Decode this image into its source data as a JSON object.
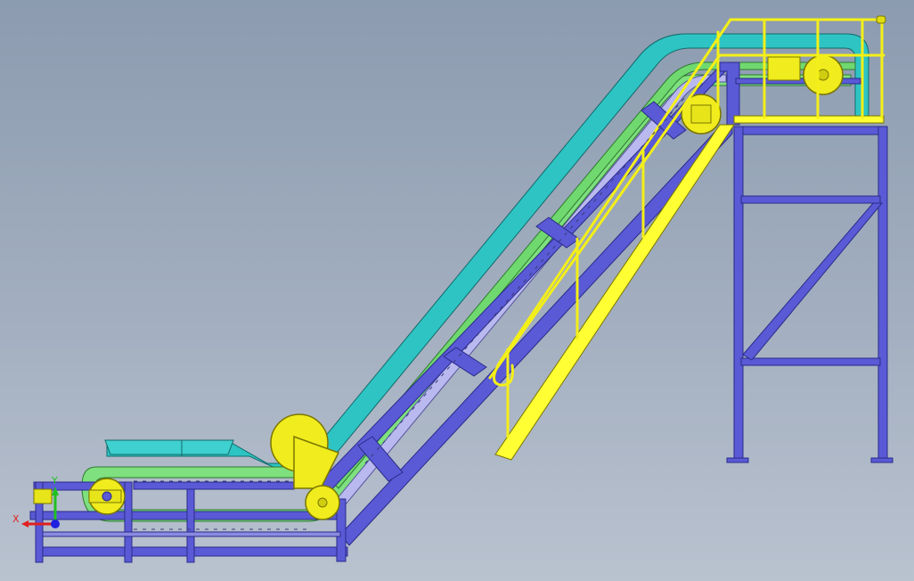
{
  "viewport": {
    "background_top": "#8c9bb0",
    "background_bottom": "#b9c2cf"
  },
  "colors": {
    "frame": "#5a5ad6",
    "frame_edge": "#2b2b8a",
    "belt_outer": "#2ec4c4",
    "belt_inner": "#7ee07e",
    "belt_light": "#b9b9f0",
    "rail": "#f4ef18",
    "rail_edge": "#8a8600",
    "drum": "#f0ec1e",
    "platform": "#ffff33"
  },
  "coord_triad": {
    "x_label": "X",
    "y_label": "Y",
    "x_color": "#e02020",
    "y_color": "#20c020",
    "z_color": "#2020e0"
  }
}
